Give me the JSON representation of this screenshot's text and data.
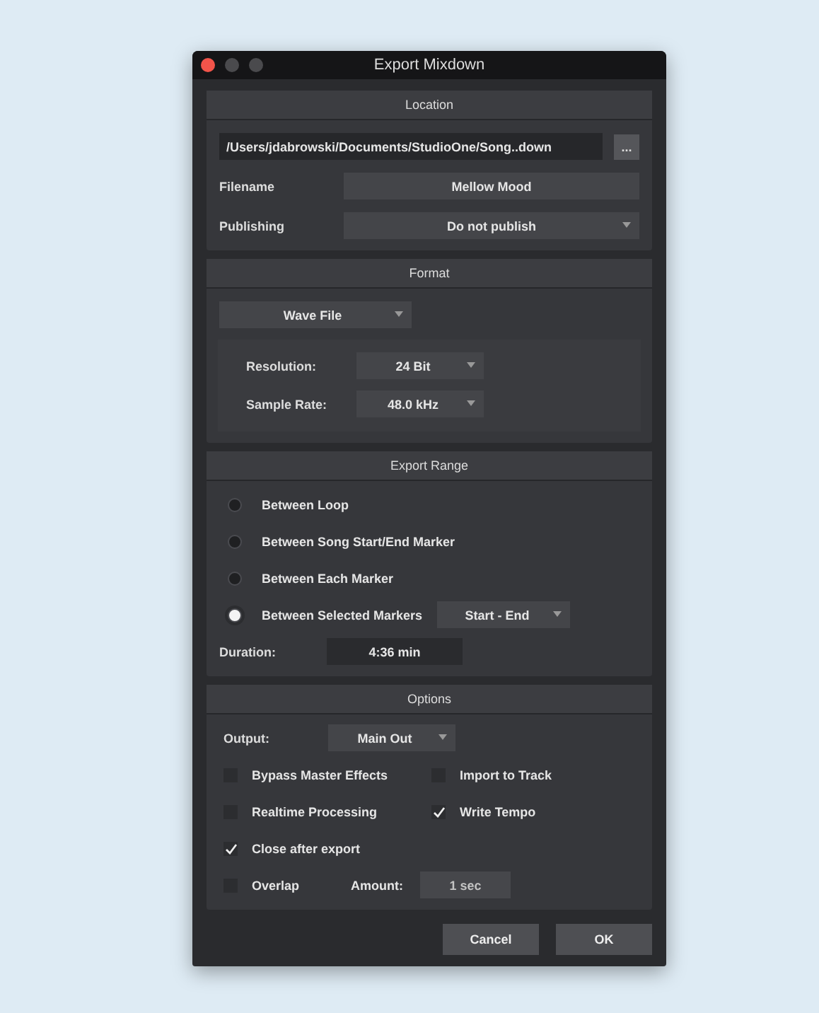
{
  "window": {
    "title": "Export Mixdown"
  },
  "location": {
    "title": "Location",
    "path": "/Users/jdabrowski/Documents/StudioOne/Song..down",
    "browse_label": "...",
    "fields": [
      {
        "label": "Filename",
        "value": "Mellow Mood",
        "kind": "text"
      },
      {
        "label": "Publishing",
        "value": "Do not publish",
        "kind": "dropdown"
      }
    ]
  },
  "format": {
    "title": "Format",
    "file_type": "Wave File",
    "settings": [
      {
        "label": "Resolution:",
        "value": "24 Bit"
      },
      {
        "label": "Sample Rate:",
        "value": "48.0 kHz"
      }
    ]
  },
  "export_range": {
    "title": "Export Range",
    "options": [
      {
        "label": "Between Loop",
        "selected": false
      },
      {
        "label": "Between Song Start/End Marker",
        "selected": false
      },
      {
        "label": "Between Each Marker",
        "selected": false
      },
      {
        "label": "Between Selected Markers",
        "selected": true,
        "dropdown": "Start - End"
      }
    ],
    "duration": {
      "label": "Duration:",
      "value": "4:36 min"
    }
  },
  "options": {
    "title": "Options",
    "output": {
      "label": "Output:",
      "value": "Main Out"
    },
    "rows": [
      [
        {
          "kind": "checkbox",
          "label": "Bypass Master Effects",
          "checked": false
        },
        {
          "kind": "checkbox",
          "label": "Import to Track",
          "checked": false
        }
      ],
      [
        {
          "kind": "checkbox",
          "label": "Realtime Processing",
          "checked": false
        },
        {
          "kind": "checkbox",
          "label": "Write Tempo",
          "checked": true
        }
      ],
      [
        {
          "kind": "checkbox",
          "label": "Close after export",
          "checked": true
        }
      ],
      [
        {
          "kind": "checkbox",
          "label": "Overlap",
          "checked": false
        },
        {
          "kind": "field",
          "label": "Amount:",
          "value": "1 sec"
        }
      ]
    ]
  },
  "buttons": [
    {
      "label": "Cancel"
    },
    {
      "label": "OK"
    }
  ]
}
